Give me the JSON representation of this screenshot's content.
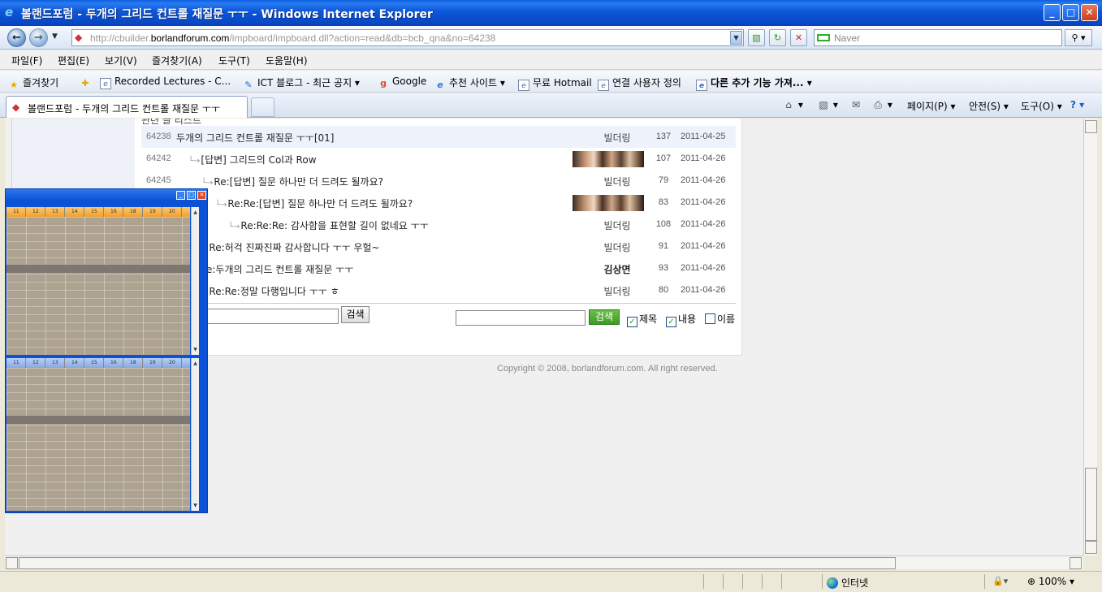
{
  "window": {
    "title": "볼랜드포럼 - 두개의 그리드 컨트롤 재질문 ㅜㅜ - Windows Internet Explorer",
    "min_label": "_",
    "max_label": "□",
    "close_label": "✕"
  },
  "address": {
    "url_prefix": "http://cbuilder.",
    "url_domain": "borlandforum.com",
    "url_suffix": "/impboard/impboard.dll?action=read&db=bcb_qna&no=64238",
    "search_placeholder": "Naver"
  },
  "menu": [
    "파일(F)",
    "편집(E)",
    "보기(V)",
    "즐겨찾기(A)",
    "도구(T)",
    "도움말(H)"
  ],
  "favorites": {
    "label": "즐겨찾기",
    "items": [
      "Recorded Lectures - C...",
      "ICT 블로그 - 최근 공지 ▾",
      "Google",
      "추천 사이트 ▾",
      "무료 Hotmail",
      "연결 사용자 정의",
      "다른 추가 기능 가져... ▾"
    ]
  },
  "tab": {
    "title": "볼랜드포럼 - 두개의 그리드 컨트롤 재질문 ㅜㅜ"
  },
  "commands": {
    "page": "페이지(P) ▾",
    "safety": "안전(S) ▾",
    "tools": "도구(O) ▾"
  },
  "board": {
    "header": "관련 글 리스트",
    "posts": [
      {
        "no": "64238",
        "subject": "두개의 그리드 컨트롤 재질문 ㅜㅜ[01]",
        "author": "빌더링",
        "hits": "137",
        "date": "2011-04-25"
      },
      {
        "no": "64242",
        "subject": "[답변] 그리드의 Col과 Row",
        "author": "",
        "hits": "107",
        "date": "2011-04-26"
      },
      {
        "no": "64245",
        "subject": "Re:[답변] 질문 하나만 더 드려도 될까요?",
        "author": "빌더링",
        "hits": "79",
        "date": "2011-04-26"
      },
      {
        "no": "",
        "subject": "Re:Re:[답변] 질문 하나만 더 드려도 될까요?",
        "author": "",
        "hits": "83",
        "date": "2011-04-26"
      },
      {
        "no": "",
        "subject": "Re:Re:Re: 감사함을 표현할 길이 없네요 ㅜㅜ",
        "author": "빌더링",
        "hits": "108",
        "date": "2011-04-26"
      },
      {
        "no": "",
        "subject": "Re:허걱 진짜진짜 감사합니다 ㅜㅜ 우헐~",
        "author": "빌더링",
        "hits": "91",
        "date": "2011-04-26"
      },
      {
        "no": "",
        "subject": "e:두개의 그리드 컨트롤 재질문 ㅜㅜ",
        "author": "김상면",
        "hits": "93",
        "date": "2011-04-26"
      },
      {
        "no": "",
        "subject": "Re:Re:정말 다행입니다 ㅜㅜ ㅎ",
        "author": "빌더링",
        "hits": "80",
        "date": "2011-04-26"
      }
    ],
    "search_btn_left": "검색",
    "search_btn_right": "검색",
    "chk_title": "제목",
    "chk_content": "내용",
    "chk_name": "이름",
    "copyright": "Copyright © 2008, borlandforum.com. All right reserved."
  },
  "popup": {
    "columns": [
      "11",
      "12",
      "13",
      "14",
      "15",
      "16",
      "18",
      "19",
      "20"
    ]
  },
  "status": {
    "zone": "인터넷",
    "zoom": "100%"
  }
}
